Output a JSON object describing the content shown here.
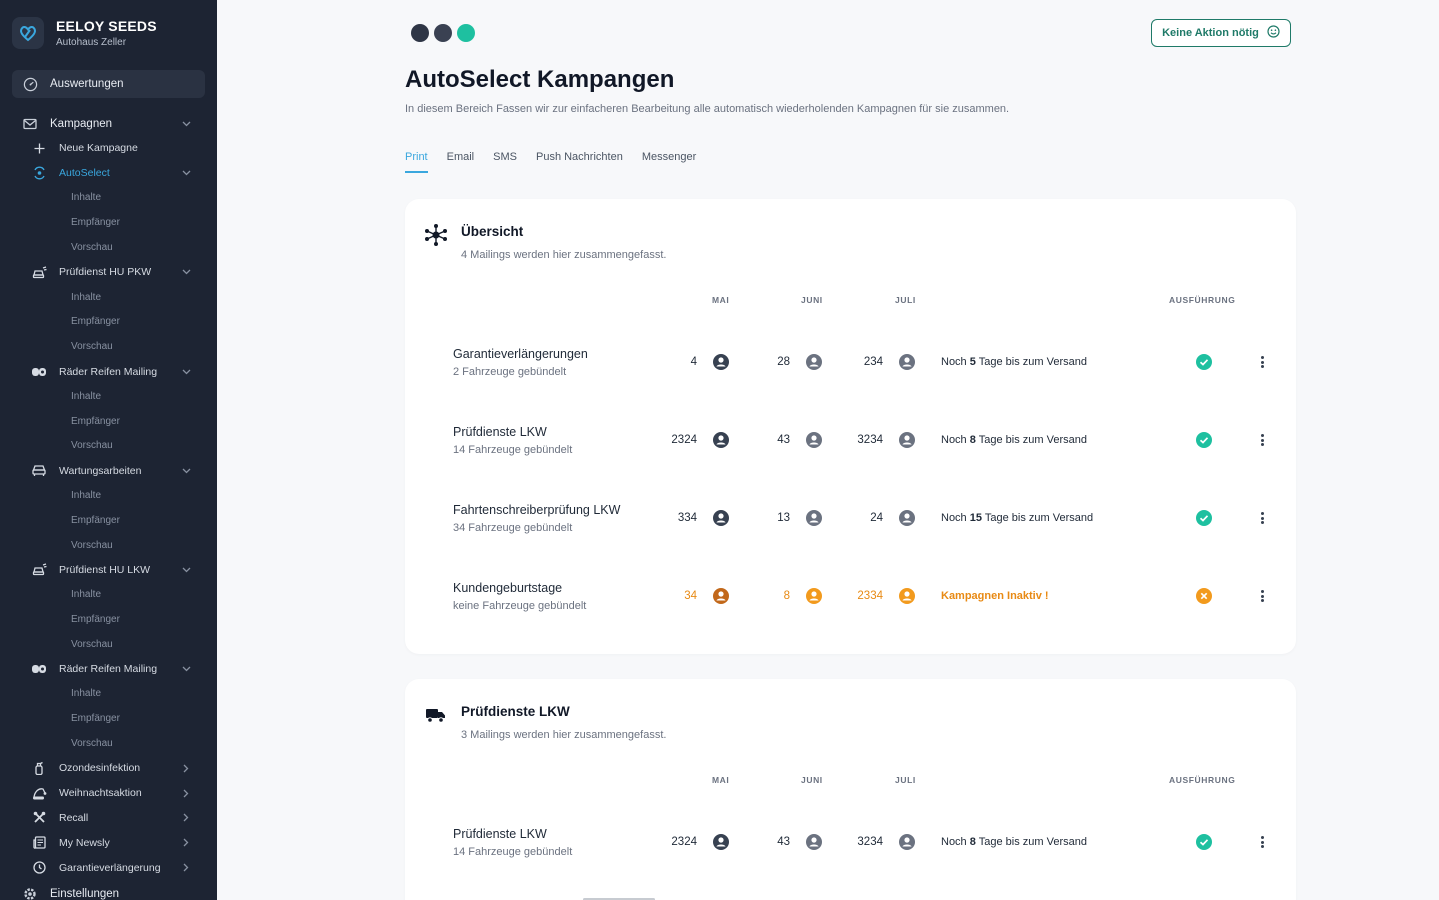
{
  "brand": {
    "name": "EELOY SEEDS",
    "sub": "Autohaus Zeller"
  },
  "sidebar": {
    "main_item": "Auswertungen",
    "section": "Kampagnen",
    "new_campaign": "Neue Kampagne",
    "groups": [
      {
        "label": "AutoSelect",
        "active": true,
        "subs": [
          "Inhalte",
          "Empfänger",
          "Vorschau"
        ]
      },
      {
        "label": "Prüfdienst HU PKW",
        "subs": [
          "Inhalte",
          "Empfänger",
          "Vorschau"
        ]
      },
      {
        "label": "Räder Reifen Mailing",
        "subs": [
          "Inhalte",
          "Empfänger",
          "Vorschau"
        ]
      },
      {
        "label": "Wartungsarbeiten",
        "subs": [
          "Inhalte",
          "Empfänger",
          "Vorschau"
        ]
      },
      {
        "label": "Prüfdienst HU LKW",
        "subs": [
          "Inhalte",
          "Empfänger",
          "Vorschau"
        ]
      },
      {
        "label": "Räder Reifen Mailing",
        "subs": [
          "Inhalte",
          "Empfänger",
          "Vorschau"
        ]
      }
    ],
    "collapsed": [
      "Ozondesinfektion",
      "Weihnachtsaktion",
      "Recall",
      "My Newsly",
      "Garantieverlängerung"
    ],
    "settings": "Einstellungen"
  },
  "header": {
    "action_button": "Keine Aktion nötig",
    "title": "AutoSelect Kampangen",
    "description": "In diesem Bereich Fassen wir zur einfacheren Bearbeitung alle automatisch wiederholenden Kampagnen für sie zusammen.",
    "tabs": [
      "Print",
      "Email",
      "SMS",
      "Push Nachrichten",
      "Messenger"
    ]
  },
  "columns": {
    "mai": "MAI",
    "juni": "JUNI",
    "juli": "JULI",
    "ausfuehrung": "AUSFÜHRUNG"
  },
  "cards": [
    {
      "title": "Übersicht",
      "sub": "4 Mailings werden hier zusammengefasst.",
      "rows": [
        {
          "name": "Garantieverlängerungen",
          "sub": "2 Fahrzeuge gebündelt",
          "mai": "4",
          "juni": "28",
          "juli": "234",
          "status_pre": "Noch ",
          "status_days": "5",
          "status_post": " Tage bis zum Versand"
        },
        {
          "name": "Prüfdienste LKW",
          "sub": "14 Fahrzeuge gebündelt",
          "mai": "2324",
          "juni": "43",
          "juli": "3234",
          "status_pre": "Noch ",
          "status_days": "8",
          "status_post": " Tage bis zum Versand"
        },
        {
          "name": "Fahrtenschreiberprüfung LKW",
          "sub": "34 Fahrzeuge gebündelt",
          "mai": "334",
          "juni": "13",
          "juli": "24",
          "status_pre": "Noch ",
          "status_days": "15",
          "status_post": " Tage bis zum Versand"
        },
        {
          "name": "Kundengeburtstage",
          "sub": "keine Fahrzeuge gebündelt",
          "mai": "34",
          "juni": "8",
          "juli": "2334",
          "status_inactive": "Kampagnen Inaktiv !"
        }
      ]
    },
    {
      "title": "Prüfdienste LKW",
      "sub": "3 Mailings werden hier zusammengefasst.",
      "rows": [
        {
          "name": "Prüfdienste LKW",
          "sub": "14 Fahrzeuge gebündelt",
          "mai": "2324",
          "juni": "43",
          "juli": "3234",
          "status_pre": "Noch ",
          "status_days": "8",
          "status_post": " Tage bis zum Versand"
        }
      ]
    }
  ],
  "colors": {
    "sidebar_bg": "#1d2433",
    "accent_blue": "#3aa7de",
    "success": "#1ec0a0",
    "warning": "#f29a1d",
    "action_green": "#1f7a68"
  }
}
